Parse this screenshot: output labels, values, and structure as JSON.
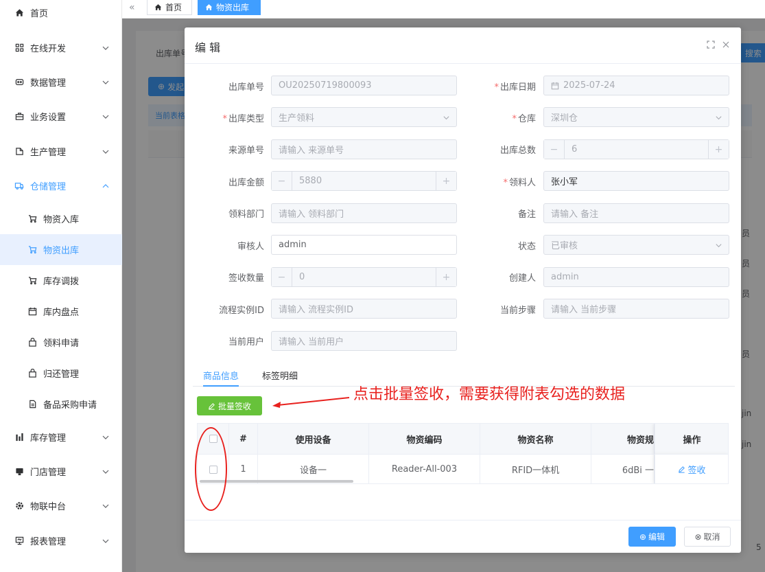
{
  "sidebar": {
    "home": "首页",
    "online_dev": "在线开发",
    "data_mgmt": "数据管理",
    "biz_settings": "业务设置",
    "production": "生产管理",
    "warehouse": "仓储管理",
    "sub_inbound": "物资入库",
    "sub_outbound": "物资出库",
    "sub_transfer": "库存调拨",
    "sub_stocktake": "库内盘点",
    "sub_requisition": "领料申请",
    "sub_return": "归还管理",
    "sub_purchase": "备品采购申请",
    "inventory": "库存管理",
    "store": "门店管理",
    "iot": "物联中台",
    "report": "报表管理"
  },
  "topbar": {
    "tab_home": "首页",
    "tab_outbound": "物资出库"
  },
  "background": {
    "filter_label": "出库单号",
    "create_btn": "发起",
    "current_table": "当前表格",
    "search_btn": "搜索",
    "role_chars": [
      "员",
      "员",
      "员",
      "员"
    ],
    "jin_chars": [
      "jin",
      "jin"
    ],
    "page_num": "5"
  },
  "dialog": {
    "title": "编 辑",
    "fields": {
      "out_no_label": "出库单号",
      "out_no_value": "OU20250719800093",
      "out_date_label": "出库日期",
      "out_date_value": "2025-07-24",
      "out_type_label": "出库类型",
      "out_type_value": "生产领料",
      "warehouse_label": "仓库",
      "warehouse_value": "深圳仓",
      "source_no_label": "来源单号",
      "source_no_placeholder": "请输入 来源单号",
      "total_label": "出库总数",
      "total_value": "6",
      "amount_label": "出库金额",
      "amount_value": "5880",
      "receiver_label": "领料人",
      "receiver_value": "张小军",
      "dept_label": "领料部门",
      "dept_placeholder": "请输入 领料部门",
      "remark_label": "备注",
      "remark_placeholder": "请输入 备注",
      "reviewer_label": "审核人",
      "reviewer_value": "admin",
      "status_label": "状态",
      "status_value": "已审核",
      "signed_qty_label": "签收数量",
      "signed_qty_value": "0",
      "creator_label": "创建人",
      "creator_value": "admin",
      "process_id_label": "流程实例ID",
      "process_id_placeholder": "请输入 流程实例ID",
      "current_step_label": "当前步骤",
      "current_step_placeholder": "请输入 当前步骤",
      "current_user_label": "当前用户",
      "current_user_placeholder": "请输入 当前用户"
    },
    "tabs": {
      "goods": "商品信息",
      "tags": "标签明细"
    },
    "batch_sign_btn": "批量签收",
    "annotation": "点击批量签收，需要获得附表勾选的数据",
    "table": {
      "headers": [
        "#",
        "使用设备",
        "物资编码",
        "物资名称",
        "物资规",
        "操作"
      ],
      "rows": [
        {
          "idx": "1",
          "device": "设备一",
          "code": "Reader-All-003",
          "name": "RFID一体机",
          "spec": "6dBi 一",
          "action": "签收"
        }
      ]
    },
    "footer": {
      "confirm": "编辑",
      "cancel": "取消"
    }
  }
}
